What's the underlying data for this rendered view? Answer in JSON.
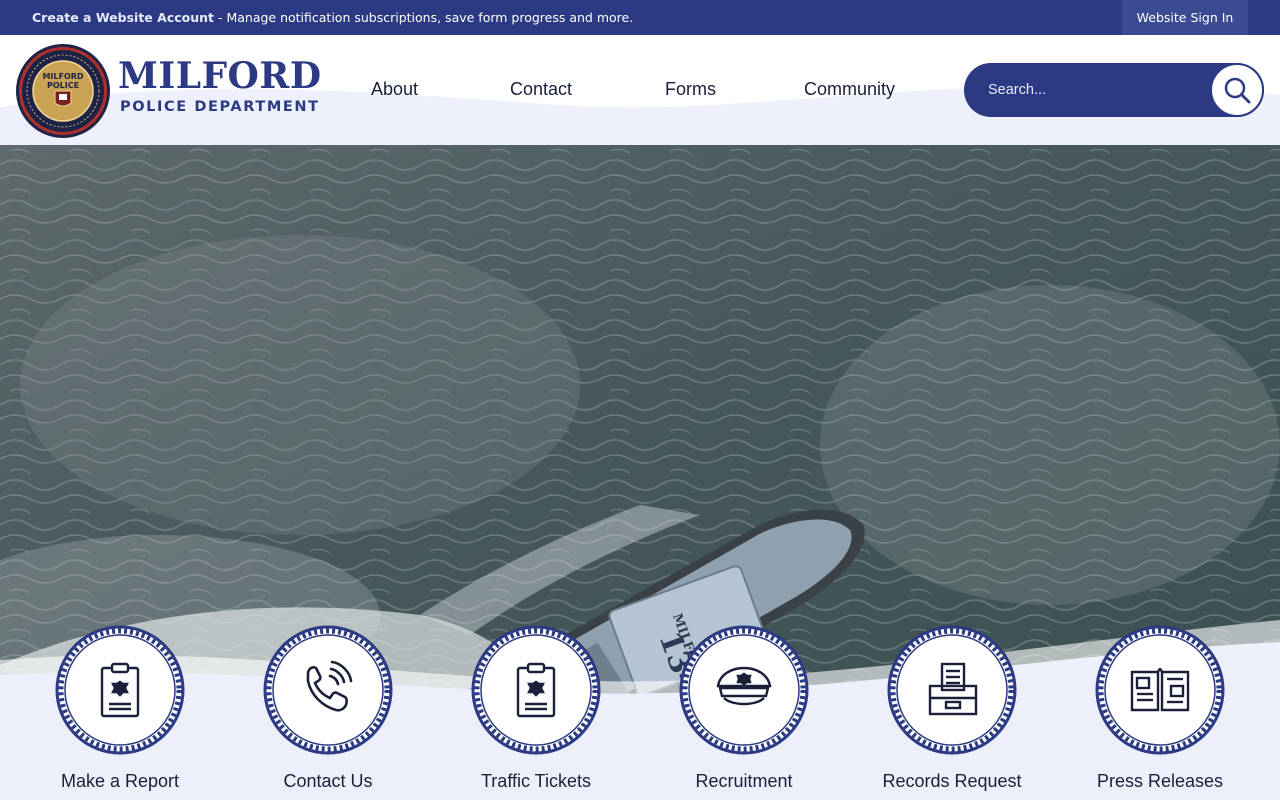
{
  "topbar": {
    "create_account": "Create a Website Account",
    "message": " - Manage notification subscriptions, save form progress and more.",
    "sign_in": "Website Sign In"
  },
  "brand": {
    "title": "MILFORD",
    "subtitle": "POLICE DEPARTMENT",
    "seal_text": "MILFORD POLICE",
    "seal_ring_words": "HONOR · COMMITMENT · INTEGRITY · TEAMWORK · RESPECT"
  },
  "nav": {
    "items": [
      {
        "label": "About"
      },
      {
        "label": "Contact"
      },
      {
        "label": "Forms"
      },
      {
        "label": "Community"
      }
    ]
  },
  "search": {
    "placeholder": "Search..."
  },
  "hero": {
    "boat_name": "MILFORD",
    "boat_number": "134"
  },
  "quick_links": [
    {
      "label": "Make a Report",
      "icon": "clipboard-badge-icon"
    },
    {
      "label": "Contact Us",
      "icon": "phone-icon"
    },
    {
      "label": "Traffic Tickets",
      "icon": "clipboard-badge-icon"
    },
    {
      "label": "Recruitment",
      "icon": "police-cap-icon"
    },
    {
      "label": "Records Request",
      "icon": "file-tray-icon"
    },
    {
      "label": "Press Releases",
      "icon": "newspaper-icon"
    }
  ],
  "colors": {
    "brand_navy": "#2b3a82",
    "band_light": "#edf0fb"
  }
}
